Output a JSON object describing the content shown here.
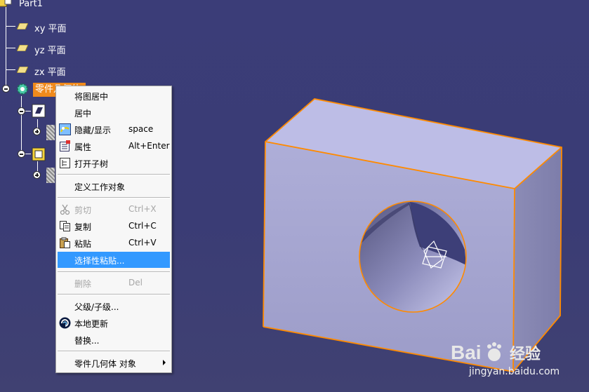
{
  "tree": {
    "root_label": "Part1",
    "planes": [
      {
        "label": "xy 平面"
      },
      {
        "label": "yz 平面"
      },
      {
        "label": "zx 平面"
      }
    ],
    "selected_label": "零件几何体"
  },
  "context_menu": {
    "items": [
      {
        "label": "将图居中",
        "shortcut": "",
        "icon": "",
        "state": "normal"
      },
      {
        "label": "居中",
        "shortcut": "",
        "icon": "",
        "state": "normal"
      },
      {
        "label": "隐藏/显示",
        "shortcut": "space",
        "icon": "hide-show-icon",
        "state": "normal"
      },
      {
        "label": "属性",
        "shortcut": "Alt+Enter",
        "icon": "properties-icon",
        "state": "normal"
      },
      {
        "label": "打开子树",
        "shortcut": "",
        "icon": "open-subtree-icon",
        "state": "normal"
      },
      {
        "label": "定义工作对象",
        "shortcut": "",
        "icon": "",
        "state": "normal"
      },
      {
        "label": "剪切",
        "shortcut": "Ctrl+X",
        "icon": "scissors-icon",
        "state": "disabled"
      },
      {
        "label": "复制",
        "shortcut": "Ctrl+C",
        "icon": "copy-icon",
        "state": "normal"
      },
      {
        "label": "粘贴",
        "shortcut": "Ctrl+V",
        "icon": "paste-icon",
        "state": "normal"
      },
      {
        "label": "选择性粘贴...",
        "shortcut": "",
        "icon": "",
        "state": "highlighted"
      },
      {
        "label": "删除",
        "shortcut": "Del",
        "icon": "",
        "state": "disabled"
      },
      {
        "label": "父级/子级...",
        "shortcut": "",
        "icon": "",
        "state": "normal"
      },
      {
        "label": "本地更新",
        "shortcut": "",
        "icon": "local-update-icon",
        "state": "normal"
      },
      {
        "label": "替换...",
        "shortcut": "",
        "icon": "",
        "state": "normal"
      },
      {
        "label": "零件几何体 对象",
        "shortcut": "",
        "icon": "",
        "state": "submenu"
      }
    ]
  },
  "watermark": {
    "logo_text": "Bai",
    "logo_suffix": "经验",
    "url": "jingyan.baidu.com"
  },
  "colors": {
    "background": "#3a3c75",
    "selection_orange": "#f08a1c",
    "menu_highlight": "#3399ff",
    "solid_face": "#b3b3e0",
    "edge_orange": "#ff8a00"
  }
}
